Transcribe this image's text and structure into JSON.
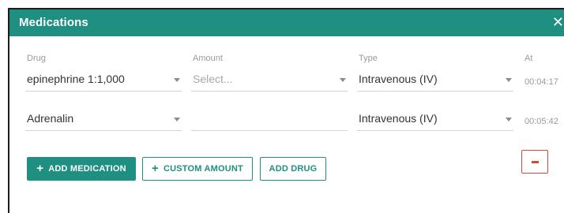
{
  "dialog": {
    "title": "Medications",
    "close_label": "✕"
  },
  "columns": {
    "drug": "Drug",
    "amount": "Amount",
    "type": "Type",
    "at": "At"
  },
  "rows": [
    {
      "drug": "epinephrine 1:1,000",
      "amount": "",
      "amount_placeholder": "Select...",
      "type": "Intravenous (IV)",
      "at": "00:04:17"
    },
    {
      "drug": "Adrenalin",
      "amount": "",
      "amount_placeholder": "",
      "type": "Intravenous (IV)",
      "at": "00:05:42"
    }
  ],
  "actions": {
    "add_medication": "ADD MEDICATION",
    "custom_amount": "CUSTOM AMOUNT",
    "add_drug": "ADD DRUG",
    "plus_icon": "+",
    "remove_icon": "minus-icon"
  },
  "colors": {
    "accent": "#1e8f80",
    "danger": "#d44a3a"
  }
}
